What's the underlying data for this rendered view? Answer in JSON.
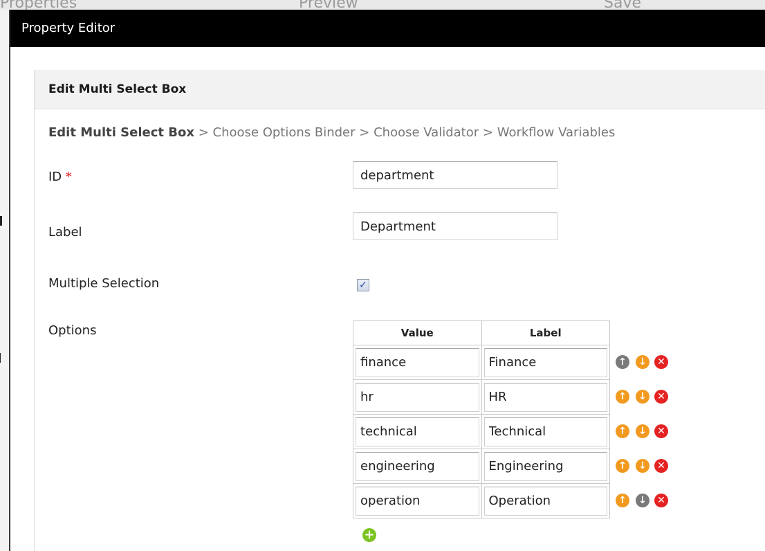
{
  "background": {
    "tabs": [
      "Properties",
      "Preview",
      "Save"
    ]
  },
  "dialog": {
    "title": "Property Editor"
  },
  "panel": {
    "heading": "Edit Multi Select Box",
    "breadcrumb": {
      "current": "Edit Multi Select Box",
      "steps": [
        "Choose Options Binder",
        "Choose Validator",
        "Workflow Variables"
      ],
      "separator": ">"
    }
  },
  "fields": {
    "id": {
      "label": "ID",
      "required_mark": "*",
      "value": "department"
    },
    "label": {
      "label": "Label",
      "value": "Department"
    },
    "multiple_selection": {
      "label": "Multiple Selection",
      "checked": true,
      "check_glyph": "✓"
    },
    "options": {
      "label": "Options"
    }
  },
  "options_grid": {
    "columns": [
      "Value",
      "Label"
    ],
    "rows": [
      {
        "value": "finance",
        "label": "Finance"
      },
      {
        "value": "hr",
        "label": "HR"
      },
      {
        "value": "technical",
        "label": "Technical"
      },
      {
        "value": "engineering",
        "label": "Engineering"
      },
      {
        "value": "operation",
        "label": "Operation"
      }
    ],
    "icons": {
      "up": "↑",
      "down": "↓",
      "delete": "✕",
      "add": "+"
    },
    "colors": {
      "enabled": "#f29a1f",
      "disabled": "#7a7a7a",
      "delete": "#e52323",
      "add": "#7cc423"
    }
  }
}
